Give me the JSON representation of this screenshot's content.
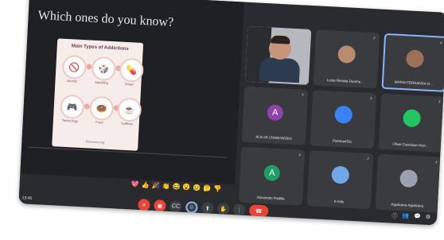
{
  "slide": {
    "title": "Which ones do you know?",
    "card_title": "Main Types of Addictions",
    "items": [
      {
        "label": "Alcohol",
        "icon": "🚫"
      },
      {
        "label": "Gambling",
        "icon": "🎲"
      },
      {
        "label": "Drugs",
        "icon": "💊"
      },
      {
        "label": "Technology",
        "icon": "🎮"
      },
      {
        "label": "Food",
        "icon": "🍩"
      },
      {
        "label": "Caffeine",
        "icon": "☕"
      }
    ],
    "footer": "Recovery.org"
  },
  "participants": [
    {
      "name": "",
      "kind": "camera"
    },
    {
      "name": "Luisa Renata Duarhe...",
      "kind": "photo",
      "color": "#b88c6f"
    },
    {
      "name": "MARIA FERNANDA G...",
      "kind": "photo",
      "color": "#a06f59",
      "active": true
    },
    {
      "name": "ALICJA CHABOWSKA",
      "kind": "avatar",
      "initial": "A",
      "color": "#8e44ad"
    },
    {
      "name": "Pasima4DS",
      "kind": "photo",
      "color": "#3b82f6"
    },
    {
      "name": "Oliver Davidson Herr...",
      "kind": "photo",
      "color": "#22c55e"
    },
    {
      "name": "Alexander Padilla",
      "kind": "avatar",
      "initial": "A",
      "color": "#1e9e63"
    },
    {
      "name": "K-mile",
      "kind": "photo",
      "color": "#6ea8e8"
    },
    {
      "name": "Aguilstera Aguilstera",
      "kind": "photo",
      "color": "#9aa3ad"
    }
  ],
  "reactions": [
    "💖",
    "👍",
    "🎉",
    "👏",
    "😂",
    "😮",
    "😢",
    "🤔",
    "👎"
  ],
  "controls": [
    {
      "name": "mic-off-button",
      "glyph": "✕",
      "style": "red"
    },
    {
      "name": "camera-off-button",
      "glyph": "▣",
      "style": "red"
    },
    {
      "name": "captions-button",
      "glyph": "CC",
      "style": ""
    },
    {
      "name": "emoji-button",
      "glyph": "☺",
      "style": "blue-ring"
    },
    {
      "name": "present-button",
      "glyph": "⬆",
      "style": ""
    },
    {
      "name": "raise-hand-button",
      "glyph": "✋",
      "style": ""
    },
    {
      "name": "more-options-button",
      "glyph": "⋮",
      "style": ""
    },
    {
      "name": "leave-call-button",
      "glyph": "☎",
      "style": "end"
    }
  ],
  "corner": [
    "ⓘ",
    "👥",
    "💬",
    "⚙"
  ],
  "time": "13:45"
}
